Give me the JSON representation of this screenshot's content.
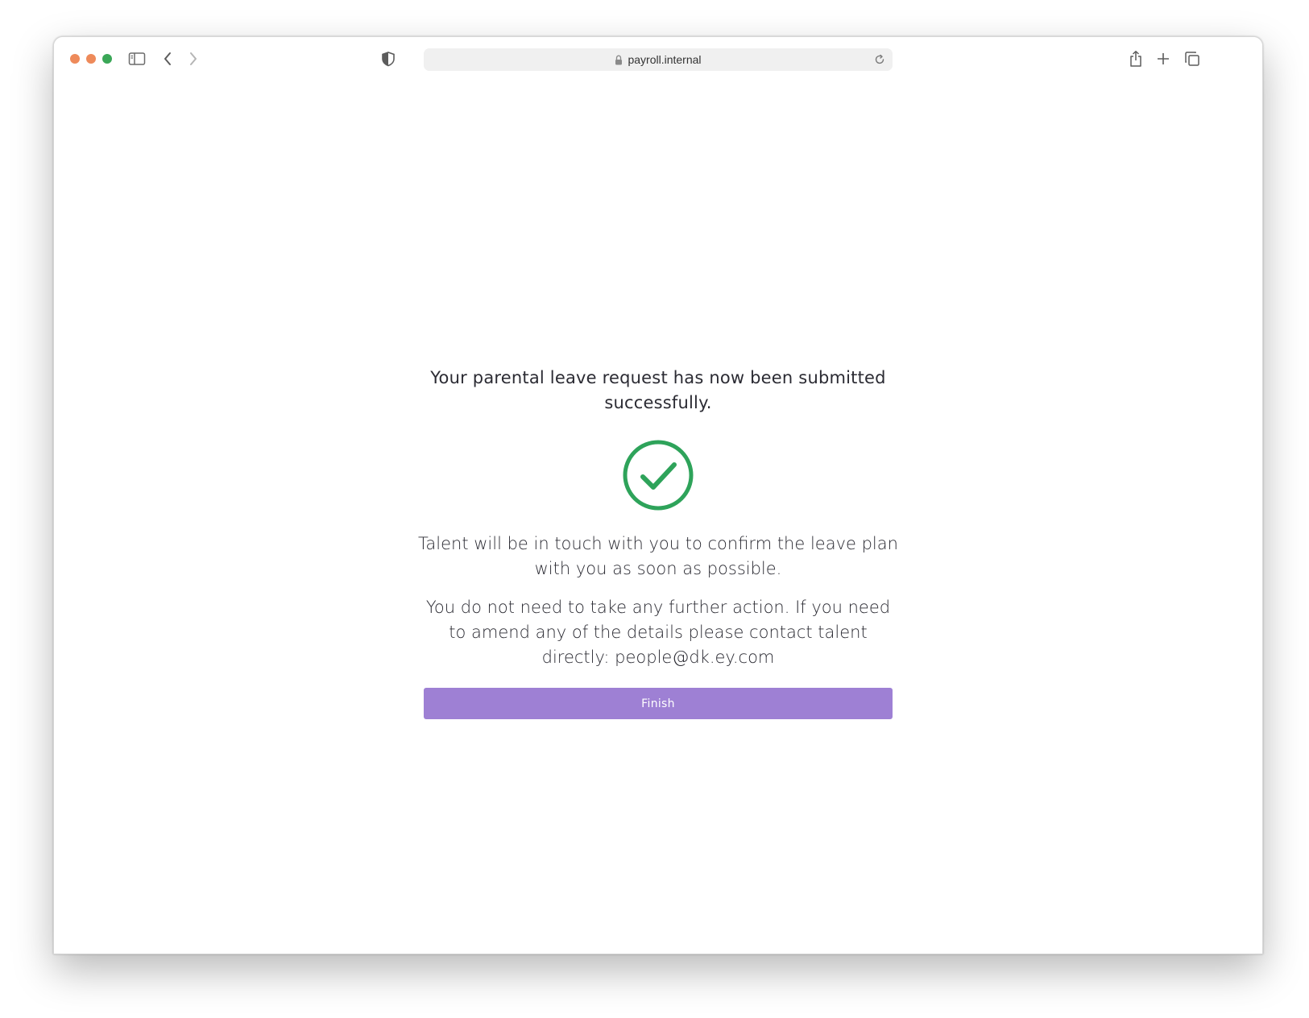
{
  "browser": {
    "url": "payroll.internal",
    "icons": {
      "close": "close-dot",
      "minimize": "minimize-dot",
      "maximize": "maximize-dot",
      "sidebar": "sidebar-toggle-icon",
      "back": "chevron-left-icon",
      "forward": "chevron-right-icon",
      "privacy": "shield-icon",
      "lock": "lock-icon",
      "reload": "reload-icon",
      "share": "share-icon",
      "new_tab": "plus-icon",
      "tabs": "tab-overview-icon"
    }
  },
  "confirmation": {
    "headline": "Your parental leave request has now been submitted successfully.",
    "success_icon": "checkmark-circle-icon",
    "success_color": "#2ea35a",
    "message_1": "Talent will be in touch with you to confirm the leave plan with you as soon as possible.",
    "message_2": "You do not need to take any further action. If you need to amend any of the details please contact talent directly: people@dk.ey.com",
    "finish_label": "Finish",
    "finish_color": "#9e80d4"
  }
}
